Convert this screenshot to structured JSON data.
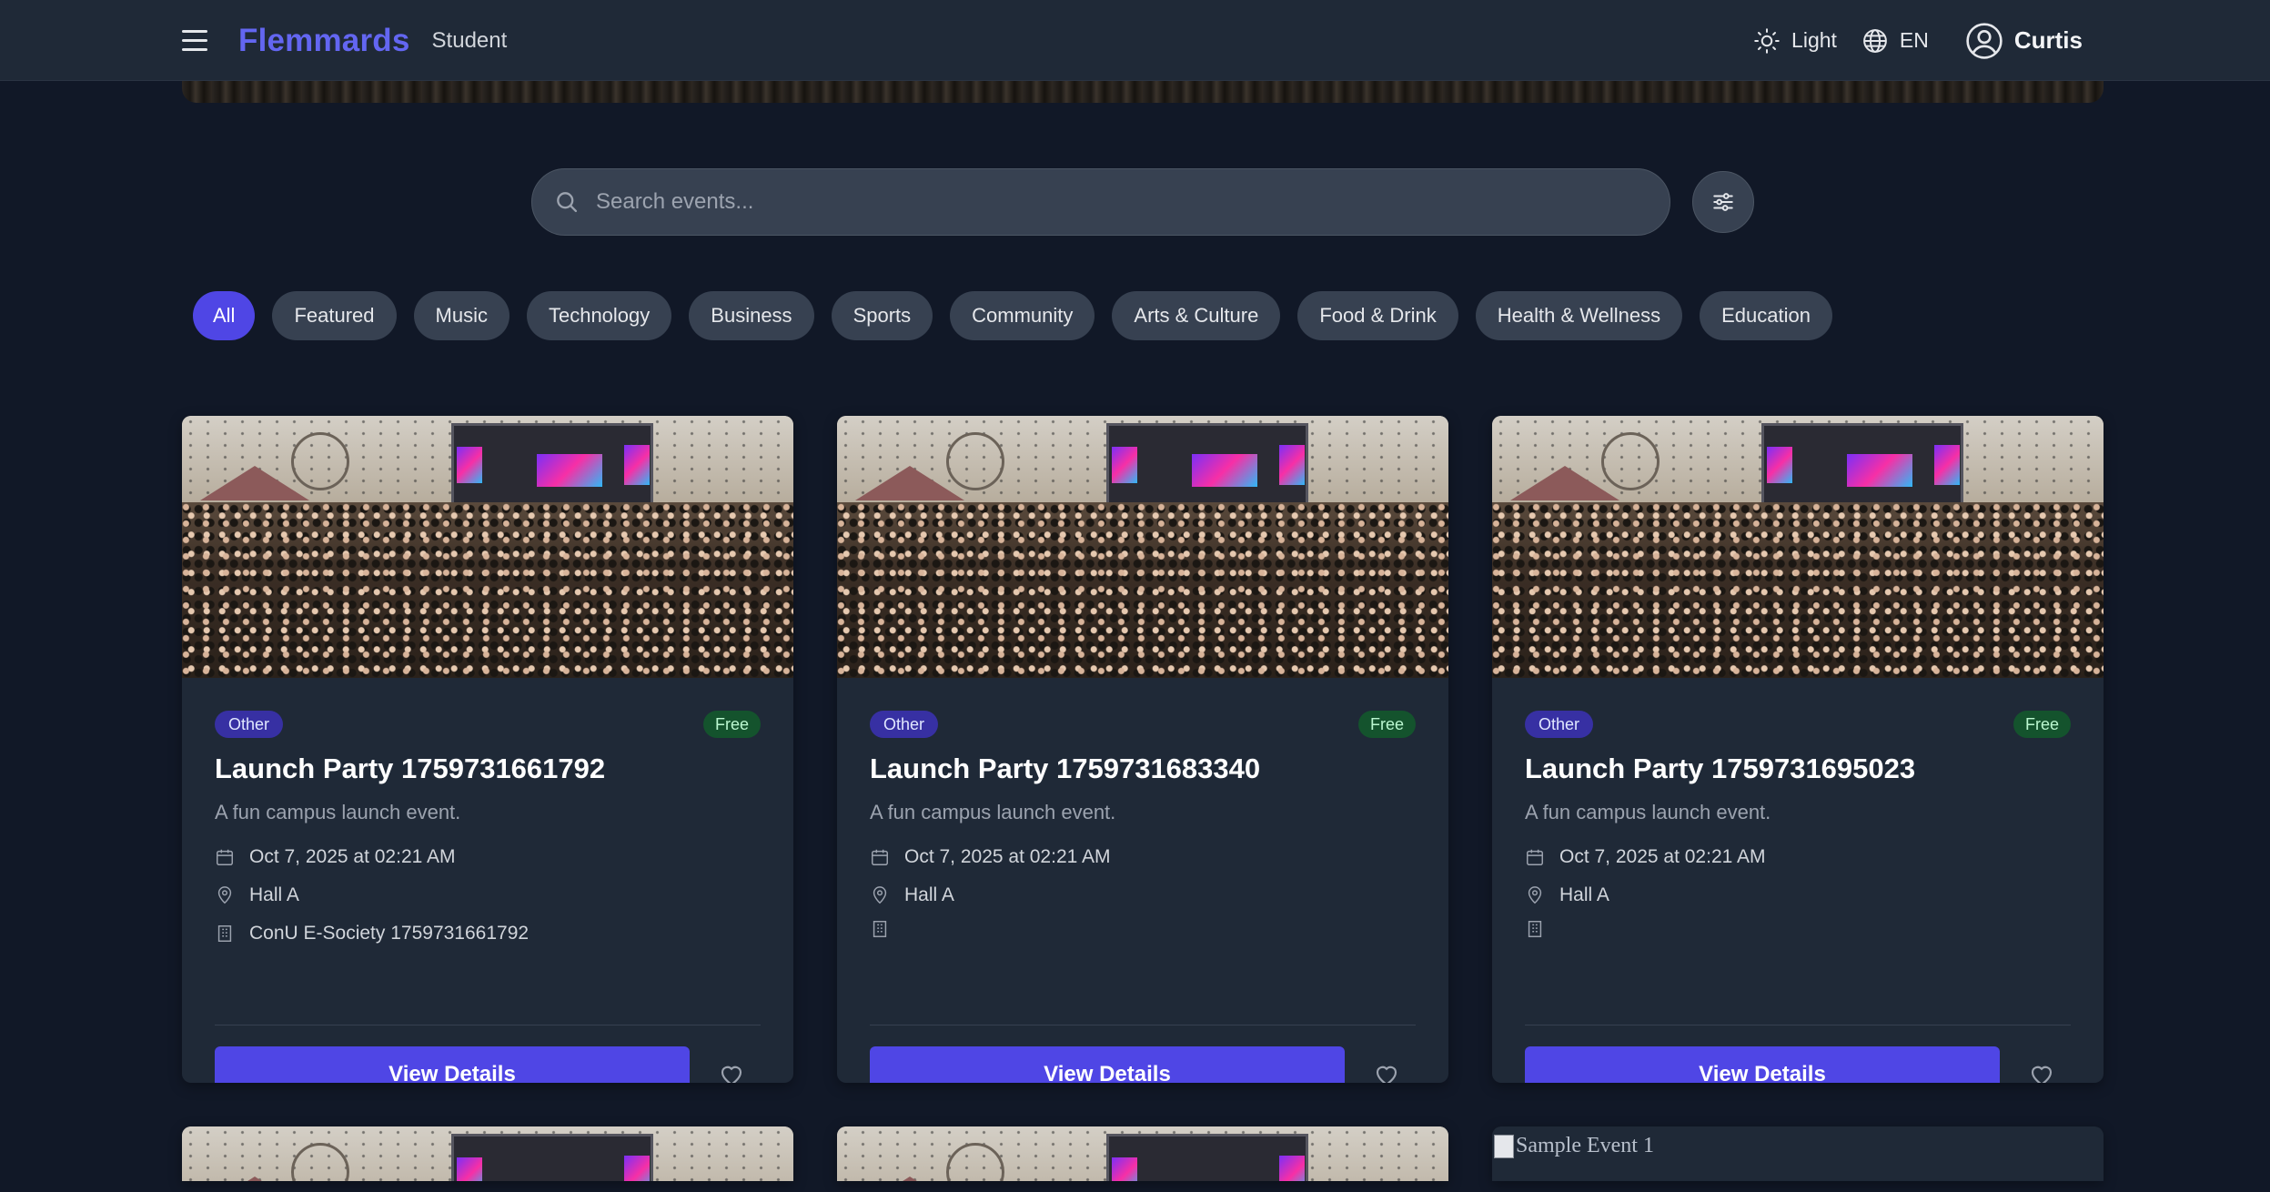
{
  "navbar": {
    "brand": "Flemmards",
    "role": "Student",
    "theme_label": "Light",
    "language_label": "EN",
    "user_name": "Curtis",
    "colors": {
      "brand": "#6366f1",
      "background": "#1f2937"
    }
  },
  "search": {
    "placeholder": "Search events..."
  },
  "categories": [
    {
      "label": "All",
      "active": true
    },
    {
      "label": "Featured"
    },
    {
      "label": "Music"
    },
    {
      "label": "Technology"
    },
    {
      "label": "Business"
    },
    {
      "label": "Sports"
    },
    {
      "label": "Community"
    },
    {
      "label": "Arts & Culture"
    },
    {
      "label": "Food & Drink"
    },
    {
      "label": "Health & Wellness"
    },
    {
      "label": "Education"
    }
  ],
  "events": [
    {
      "category": "Other",
      "price": "Free",
      "title": "Launch Party 1759731661792",
      "description": "A fun campus launch event.",
      "date": "Oct 7, 2025 at 02:21 AM",
      "location": "Hall A",
      "organizer": "ConU E-Society 1759731661792",
      "button": "View Details"
    },
    {
      "category": "Other",
      "price": "Free",
      "title": "Launch Party 1759731683340",
      "description": "A fun campus launch event.",
      "date": "Oct 7, 2025 at 02:21 AM",
      "location": "Hall A",
      "organizer": "",
      "button": "View Details"
    },
    {
      "category": "Other",
      "price": "Free",
      "title": "Launch Party 1759731695023",
      "description": "A fun campus launch event.",
      "date": "Oct 7, 2025 at 02:21 AM",
      "location": "Hall A",
      "organizer": "",
      "button": "View Details"
    }
  ],
  "next_row": {
    "broken_image_alt": "Sample Event 1"
  },
  "colors": {
    "accent": "#4f46e5",
    "category_badge": "#3730a3",
    "free_badge": "#14532d",
    "page_background": "#111827",
    "card_background": "#1f2937"
  }
}
